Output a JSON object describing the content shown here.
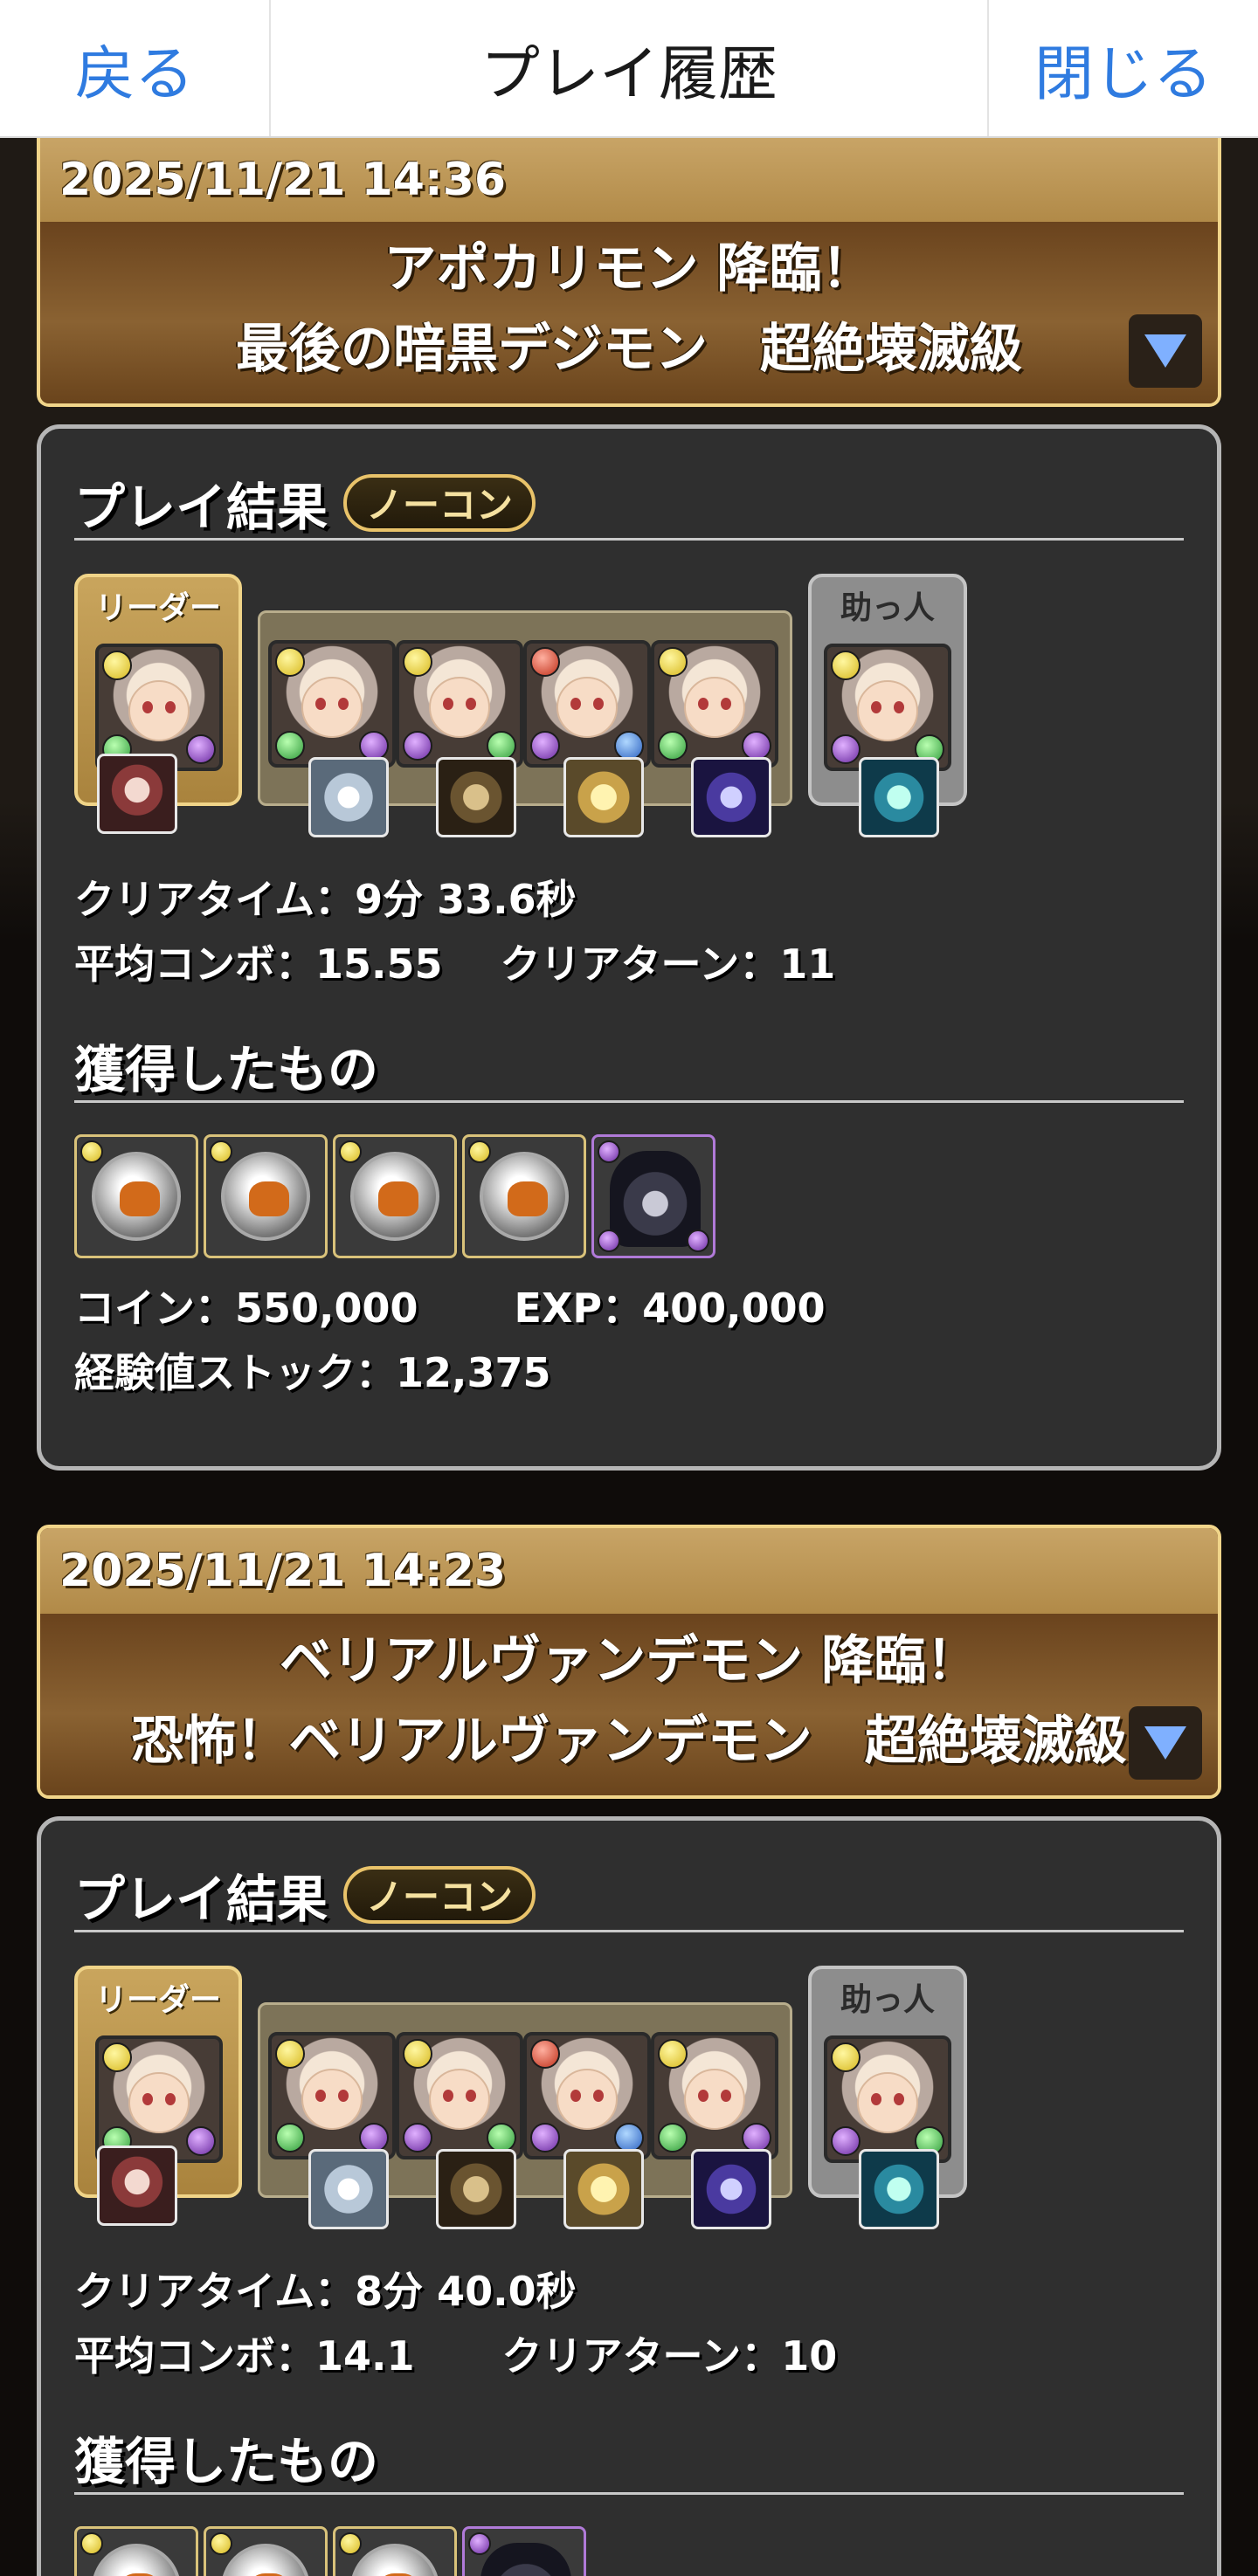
{
  "nav": {
    "back": "戻る",
    "title": "プレイ履歴",
    "close": "閉じる"
  },
  "common": {
    "result_title": "プレイ結果",
    "badge": "ノーコン",
    "leader_label": "リーダー",
    "helper_label": "助っ人",
    "obtained_title": "獲得したもの"
  },
  "entries": [
    {
      "date": "2025/11/21 14:36",
      "title1": "アポカリモン 降臨！",
      "title2": "最後の暗黒デジモン　超絶壊滅級",
      "clear_time": "クリアタイム：9分 33.6秒",
      "avg_combo": "平均コンボ：15.55",
      "clear_turn": "クリアターン：11",
      "coin": "コイン：550,000",
      "exp": "EXP：400,000",
      "exp_stock": "経験値ストック：12,375"
    },
    {
      "date": "2025/11/21 14:23",
      "title1": "ベリアルヴァンデモン 降臨！",
      "title2": "恐怖！ベリアルヴァンデモン　超絶壊滅級",
      "clear_time": "クリアタイム：8分 40.0秒",
      "avg_combo": "平均コンボ：14.1",
      "clear_turn": "クリアターン：10"
    }
  ]
}
